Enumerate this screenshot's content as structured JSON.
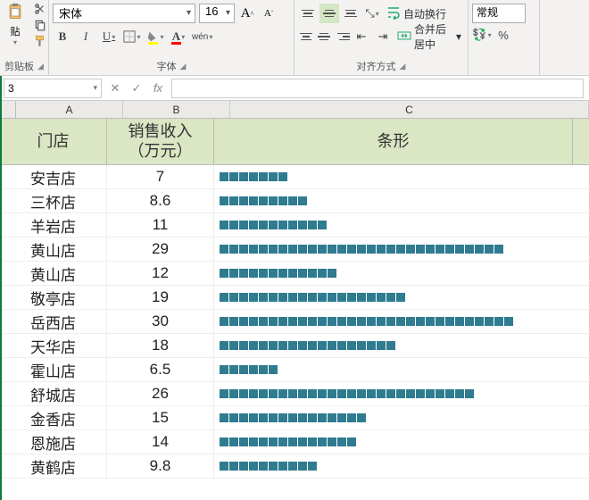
{
  "ribbon": {
    "clipboard": {
      "paste_label": "贴",
      "group_label": "剪贴板"
    },
    "font": {
      "name": "宋体",
      "size": "16",
      "group_label": "字体",
      "bold": "B",
      "italic": "I",
      "underline": "U",
      "wen": "wén"
    },
    "alignment": {
      "group_label": "对齐方式",
      "wrap_label": "自动换行",
      "merge_label": "合并后居中"
    },
    "number": {
      "format": "常规",
      "group_label": ""
    }
  },
  "namebox": "3",
  "columns": {
    "A": "A",
    "B": "B",
    "C": "C"
  },
  "headers": {
    "store": "门店",
    "revenue": "销售收入\n（万元）",
    "bar": "条形"
  },
  "chart_data": {
    "type": "bar",
    "title": "",
    "xlabel": "条形",
    "ylabel": "销售收入（万元）",
    "categories": [
      "安吉店",
      "三杯店",
      "羊岩店",
      "黄山店",
      "黄山店",
      "敬亭店",
      "岳西店",
      "天华店",
      "霍山店",
      "舒城店",
      "金香店",
      "恩施店",
      "黄鹤店"
    ],
    "values": [
      7,
      8.6,
      11,
      29,
      12,
      19,
      30,
      18,
      6.5,
      26,
      15,
      14,
      9.8
    ],
    "ylim": [
      0,
      30
    ]
  },
  "rows": [
    {
      "store": "安吉店",
      "revenue": "7",
      "bars": 7
    },
    {
      "store": "三杯店",
      "revenue": "8.6",
      "bars": 9
    },
    {
      "store": "羊岩店",
      "revenue": "11",
      "bars": 11
    },
    {
      "store": "黄山店",
      "revenue": "29",
      "bars": 29
    },
    {
      "store": "黄山店",
      "revenue": "12",
      "bars": 12
    },
    {
      "store": "敬亭店",
      "revenue": "19",
      "bars": 19
    },
    {
      "store": "岳西店",
      "revenue": "30",
      "bars": 30
    },
    {
      "store": "天华店",
      "revenue": "18",
      "bars": 18
    },
    {
      "store": "霍山店",
      "revenue": "6.5",
      "bars": 6
    },
    {
      "store": "舒城店",
      "revenue": "26",
      "bars": 26
    },
    {
      "store": "金香店",
      "revenue": "15",
      "bars": 15
    },
    {
      "store": "恩施店",
      "revenue": "14",
      "bars": 14
    },
    {
      "store": "黄鹤店",
      "revenue": "9.8",
      "bars": 10
    }
  ]
}
